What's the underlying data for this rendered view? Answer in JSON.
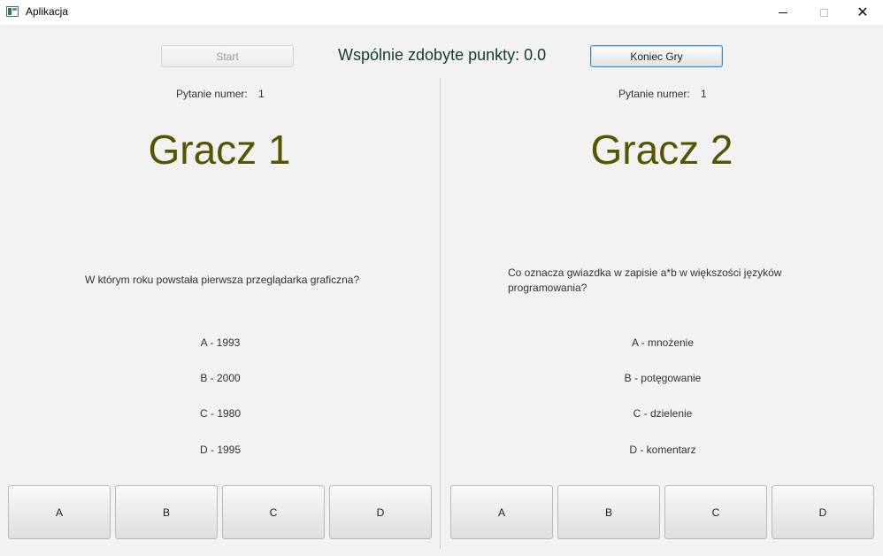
{
  "window": {
    "title": "Aplikacja",
    "close_glyph": "✕"
  },
  "controls": {
    "start_label": "Start",
    "score_text": "Wspólnie zdobyte punkty: 0.0",
    "end_label": "Koniec Gry"
  },
  "player1": {
    "question_label": "Pytanie numer:",
    "question_number": "1",
    "name": "Gracz 1",
    "question": "W którym roku powstała pierwsza przeglądarka graficzna?",
    "answers": [
      "A - 1993",
      "B - 2000",
      "C - 1980",
      "D - 1995"
    ],
    "buttons": [
      "A",
      "B",
      "C",
      "D"
    ]
  },
  "player2": {
    "question_label": "Pytanie numer:",
    "question_number": "1",
    "name": "Gracz 2",
    "question": "Co oznacza gwiazdka w zapisie a*b w większości języków programowania?",
    "answers": [
      "A - mnożenie",
      "B - potęgowanie",
      "C - dzielenie",
      "D - komentarz"
    ],
    "buttons": [
      "A",
      "B",
      "C",
      "D"
    ]
  },
  "colors": {
    "player_name": "#555500",
    "score_text": "#143c2a",
    "focus_border": "#3a8ad0"
  }
}
